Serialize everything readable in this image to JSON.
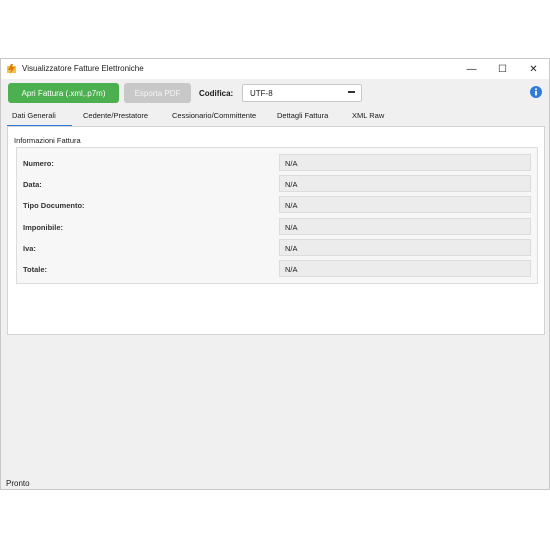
{
  "window": {
    "title": "Visualizzatore Fatture Elettroniche",
    "controls": {
      "minimize": "—",
      "maximize": "☐",
      "close": "✕"
    }
  },
  "toolbar": {
    "open_label": "Apri Fattura (.xml,.p7m)",
    "export_label": "Esporta PDF",
    "encoding_label": "Codifica:",
    "encoding_value": "UTF-8",
    "accent_color": "#4caf50"
  },
  "tabs": [
    {
      "label": "Dati Generali",
      "active": true
    },
    {
      "label": "Cedente/Prestatore",
      "active": false
    },
    {
      "label": "Cessionario/Committente",
      "active": false
    },
    {
      "label": "Dettagli Fattura",
      "active": false
    },
    {
      "label": "XML Raw",
      "active": false
    }
  ],
  "panel": {
    "group_title": "Informazioni Fattura",
    "fields": [
      {
        "label": "Numero:",
        "value": "N/A"
      },
      {
        "label": "Data:",
        "value": "N/A"
      },
      {
        "label": "Tipo Documento:",
        "value": "N/A"
      },
      {
        "label": "Imponibile:",
        "value": "N/A"
      },
      {
        "label": "Iva:",
        "value": "N/A"
      },
      {
        "label": "Totale:",
        "value": "N/A"
      }
    ]
  },
  "status": {
    "text": "Pronto"
  },
  "icons": {
    "app": "lightning-folder-icon",
    "info": "info-icon",
    "caret": "dropdown-caret-icon"
  }
}
